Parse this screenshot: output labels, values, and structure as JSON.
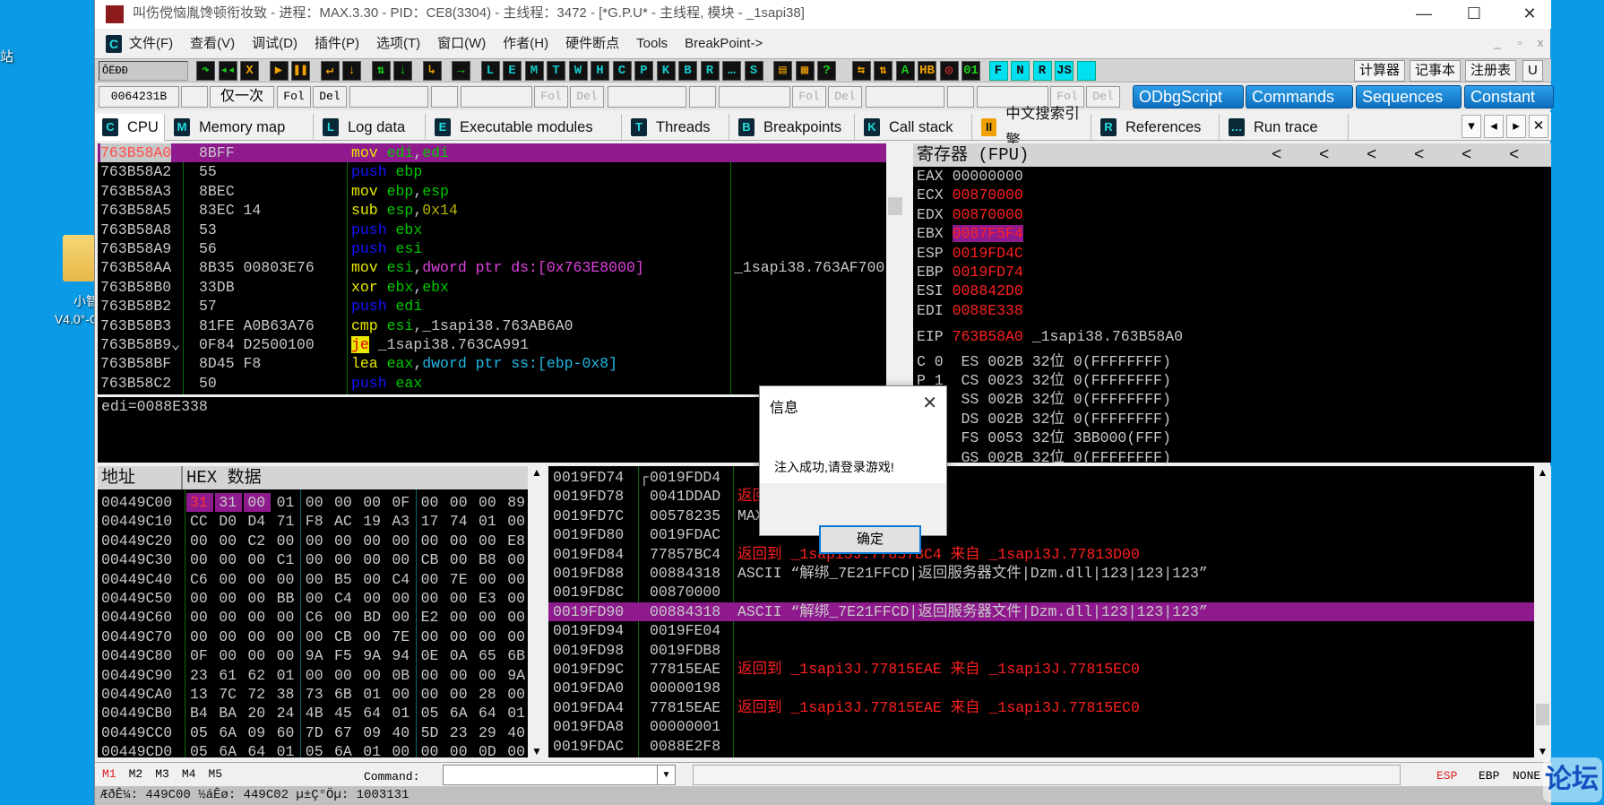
{
  "desktop": {
    "top_label": "站",
    "folder_label_1": "小智",
    "folder_label_2": "V4.0°-C"
  },
  "window": {
    "title": "叫伤傥恼胤馋顿衔妆致 - 进程：MAX.3.30 - PID：CE8(3304) - 主线程：3472 - [*G.P.U* -  主线程, 模块 - _1sapi38]",
    "min": "—",
    "max": "☐",
    "close": "✕"
  },
  "menu": {
    "items": [
      "文件(F)",
      "查看(V)",
      "调试(D)",
      "插件(P)",
      "选项(T)",
      "窗口(W)",
      "作者(H)",
      "硬件断点",
      "Tools",
      "BreakPoint->"
    ],
    "mdi": [
      "_",
      "▫",
      "x"
    ]
  },
  "toolbar": {
    "run_label": "ÔËÐÐ",
    "icons": [
      [
        "↷",
        "#19d119"
      ],
      [
        "◂◂",
        "#19d119"
      ],
      [
        "X",
        "#f0a000"
      ],
      [
        "▶",
        "#f0a000"
      ],
      [
        "❚❚",
        "#f0a000"
      ],
      [
        "↵",
        "#f0a000"
      ],
      [
        "↓",
        "#f0a000"
      ],
      [
        "⇅",
        "#19d119"
      ],
      [
        "↓",
        "#19d119"
      ],
      [
        "↳",
        "#f0a000"
      ],
      [
        "→",
        "#19d119"
      ],
      [
        "L",
        "#18c8c8"
      ],
      [
        "E",
        "#18c8c8"
      ],
      [
        "M",
        "#18c8c8"
      ],
      [
        "T",
        "#18c8c8"
      ],
      [
        "W",
        "#18c8c8"
      ],
      [
        "H",
        "#18c8c8"
      ],
      [
        "C",
        "#18c8c8"
      ],
      [
        "P",
        "#18c8c8"
      ],
      [
        "K",
        "#18c8c8"
      ],
      [
        "B",
        "#18c8c8"
      ],
      [
        "R",
        "#18c8c8"
      ],
      [
        "…",
        "#18c8c8"
      ],
      [
        "S",
        "#18c8c8"
      ],
      [
        "▤",
        "#f0a000"
      ],
      [
        "▦",
        "#f0a000"
      ],
      [
        "?",
        "#19d119"
      ],
      [
        "⇆",
        "#f0a000"
      ],
      [
        "⇅",
        "#f0a000"
      ],
      [
        "A",
        "#19d119"
      ],
      [
        "HB",
        "#f0a000"
      ],
      [
        "◎",
        "#e03030"
      ],
      [
        "01",
        "#19d119"
      ],
      [
        "F",
        "#111"
      ],
      [
        "N",
        "#111"
      ],
      [
        "R",
        "#111"
      ],
      [
        "JS",
        "#111"
      ],
      [
        "",
        "#111"
      ]
    ],
    "right_buttons": [
      "计算器",
      "记事本",
      "注册表",
      "U"
    ]
  },
  "row2": {
    "address": "0064231B",
    "once": "仅一次",
    "fol": "Fol",
    "del": "Del",
    "script_buttons": [
      "ODbgScript",
      "Commands",
      "Sequences",
      "Constant"
    ]
  },
  "tabs": [
    {
      "icon": "C",
      "label": "CPU"
    },
    {
      "icon": "M",
      "label": "Memory map"
    },
    {
      "icon": "L",
      "label": "Log data"
    },
    {
      "icon": "E",
      "label": "Executable modules"
    },
    {
      "icon": "T",
      "label": "Threads"
    },
    {
      "icon": "B",
      "label": "Breakpoints"
    },
    {
      "icon": "K",
      "label": "Call stack"
    },
    {
      "icon": "II",
      "label": "中文搜索引擎"
    },
    {
      "icon": "R",
      "label": "References"
    },
    {
      "icon": "…",
      "label": "Run trace"
    }
  ],
  "tab_nav": [
    "▾",
    "◂",
    "▸",
    "✕"
  ],
  "disasm": [
    {
      "addr": "763B58A0",
      "mark": "",
      "hex": "8BFF",
      "ins": [
        [
          "mov",
          "y"
        ],
        [
          " edi",
          "g"
        ],
        [
          ",",
          "w"
        ],
        [
          "edi",
          "g"
        ]
      ],
      "cmt": "",
      "sel": true
    },
    {
      "addr": "763B58A2",
      "mark": "",
      "hex": "55",
      "ins": [
        [
          "push",
          "b"
        ],
        [
          " ebp",
          "g"
        ]
      ],
      "cmt": ""
    },
    {
      "addr": "763B58A3",
      "mark": "",
      "hex": "8BEC",
      "ins": [
        [
          "mov",
          "y"
        ],
        [
          " ebp",
          "g"
        ],
        [
          ",",
          "w"
        ],
        [
          "esp",
          "g"
        ]
      ],
      "cmt": ""
    },
    {
      "addr": "763B58A5",
      "mark": "",
      "hex": "83EC 14",
      "ins": [
        [
          "sub",
          "y"
        ],
        [
          " esp",
          "g"
        ],
        [
          ",",
          "w"
        ],
        [
          "0x14",
          "o"
        ]
      ],
      "cmt": ""
    },
    {
      "addr": "763B58A8",
      "mark": "",
      "hex": "53",
      "ins": [
        [
          "push",
          "b"
        ],
        [
          " ebx",
          "g"
        ]
      ],
      "cmt": ""
    },
    {
      "addr": "763B58A9",
      "mark": "",
      "hex": "56",
      "ins": [
        [
          "push",
          "b"
        ],
        [
          " esi",
          "g"
        ]
      ],
      "cmt": ""
    },
    {
      "addr": "763B58AA",
      "mark": "",
      "hex": "8B35 00803E76",
      "ins": [
        [
          "mov",
          "y"
        ],
        [
          " esi",
          "g"
        ],
        [
          ",",
          "w"
        ],
        [
          "dword ptr ds:[0x763E8000]",
          "m"
        ]
      ],
      "cmt": "_1sapi38.763AF700"
    },
    {
      "addr": "763B58B0",
      "mark": "",
      "hex": "33DB",
      "ins": [
        [
          "xor",
          "y"
        ],
        [
          " ebx",
          "g"
        ],
        [
          ",",
          "w"
        ],
        [
          "ebx",
          "g"
        ]
      ],
      "cmt": ""
    },
    {
      "addr": "763B58B2",
      "mark": "",
      "hex": "57",
      "ins": [
        [
          "push",
          "b"
        ],
        [
          " edi",
          "g"
        ]
      ],
      "cmt": ""
    },
    {
      "addr": "763B58B3",
      "mark": "",
      "hex": "81FE A0B63A76",
      "ins": [
        [
          "cmp",
          "y"
        ],
        [
          " esi",
          "g"
        ],
        [
          ",",
          "w"
        ],
        [
          "_1sapi38.763AB6A0",
          "w"
        ]
      ],
      "cmt": ""
    },
    {
      "addr": "763B58B9",
      "mark": "⌄",
      "hex": "0F84 D2500100",
      "ins": [
        [
          "je",
          "jh"
        ],
        [
          " _1sapi38.763CA991",
          "w"
        ]
      ],
      "cmt": ""
    },
    {
      "addr": "763B58BF",
      "mark": "",
      "hex": "8D45 F8",
      "ins": [
        [
          "lea",
          "y"
        ],
        [
          " eax",
          "g"
        ],
        [
          ",",
          "w"
        ],
        [
          "dword ptr ss:[ebp-0x8]",
          "c"
        ]
      ],
      "cmt": ""
    },
    {
      "addr": "763B58C2",
      "mark": "",
      "hex": "50",
      "ins": [
        [
          "push",
          "b"
        ],
        [
          " eax",
          "g"
        ]
      ],
      "cmt": ""
    }
  ],
  "info": {
    "text": "edi=0088E338"
  },
  "registers": {
    "title": "寄存器 (FPU)",
    "arrows": [
      "<",
      "<",
      "<",
      "<",
      "<",
      "<"
    ],
    "gp": [
      [
        "EAX",
        "00000000",
        false
      ],
      [
        "ECX",
        "00870000",
        true
      ],
      [
        "EDX",
        "00870000",
        true
      ],
      [
        "EBX",
        "0087F5F4",
        true
      ],
      [
        "ESP",
        "0019FD4C",
        true
      ],
      [
        "EBP",
        "0019FD74",
        true
      ],
      [
        "ESI",
        "008842D0",
        true
      ],
      [
        "EDI",
        "0088E338",
        true
      ]
    ],
    "eip": {
      "name": "EIP",
      "value": "763B58A0",
      "label": "_1sapi38.763B58A0"
    },
    "seg": [
      "C 0  ES 002B 32位 0(FFFFFFFF)",
      "P 1  CS 0023 32位 0(FFFFFFFF)",
      "     SS 002B 32位 0(FFFFFFFF)",
      "     DS 002B 32位 0(FFFFFFFF)",
      "     FS 0053 32位 3BB000(FFF)",
      "     GS 002B 32位 0(FFFFFFFF)"
    ]
  },
  "dump": {
    "col_addr": "地址",
    "col_hex": "HEX 数据",
    "rows": [
      [
        "00449C00",
        "31 31 00 01 00 00 00 0F 00 00 00 89"
      ],
      [
        "00449C10",
        "CC D0 D4 71 F8 AC 19 A3 17 74 01 00"
      ],
      [
        "00449C20",
        "00 00 C2 00 00 00 00 00 00 00 00 E8"
      ],
      [
        "00449C30",
        "00 00 00 C1 00 00 00 00 CB 00 B8 00"
      ],
      [
        "00449C40",
        "C6 00 00 00 00 B5 00 C4 00 7E 00 00"
      ],
      [
        "00449C50",
        "00 00 00 BB 00 C4 00 00 00 00 E3 00"
      ],
      [
        "00449C60",
        "00 00 00 00 C6 00 BD 00 E2 00 00 00"
      ],
      [
        "00449C70",
        "00 00 00 00 00 CB 00 7E 00 00 00 00"
      ],
      [
        "00449C80",
        "0F 00 00 00 9A F5 9A 94 0E 0A 65 6B"
      ],
      [
        "00449C90",
        "23 61 62 01 00 00 00 0B 00 00 00 9A"
      ],
      [
        "00449CA0",
        "13 7C 72 38 73 6B 01 00 00 00 28 00"
      ],
      [
        "00449CB0",
        "B4 BA 20 24 4B 45 64 01 05 6A 64 01"
      ],
      [
        "00449CC0",
        "05 6A 09 60 7D 67 09 40 5D 23 29 40"
      ],
      [
        "00449CD0",
        "05 6A 64 01 05 6A 01 00 00 00 0D 00"
      ]
    ]
  },
  "stack": [
    {
      "addr": "0019FD74",
      "val": "0019FDD4",
      "cmt": "",
      "red": false,
      "br": "┌"
    },
    {
      "addr": "0019FD78",
      "val": "0041DDAD",
      "cmt": "返回到 MAX.0041DDAD",
      "red": true
    },
    {
      "addr": "0019FD7C",
      "val": "00578235",
      "cmt": "MAX.00578235",
      "red": false
    },
    {
      "addr": "0019FD80",
      "val": "0019FDAC",
      "cmt": "",
      "red": false
    },
    {
      "addr": "0019FD84",
      "val": "77857BC4",
      "cmt": "返回到 _1sapi3J.77857BC4 来自 _1sapi3J.77813D00",
      "red": true
    },
    {
      "addr": "0019FD88",
      "val": "00884318",
      "cmt": "ASCII “解绑_7E21FFCD|返回服务器文件|Dzm.dll|123|123|123”",
      "red": false
    },
    {
      "addr": "0019FD8C",
      "val": "00870000",
      "cmt": "",
      "red": false
    },
    {
      "addr": "0019FD90",
      "val": "00884318",
      "cmt": "ASCII “解绑_7E21FFCD|返回服务器文件|Dzm.dll|123|123|123”",
      "red": false,
      "sel": true
    },
    {
      "addr": "0019FD94",
      "val": "0019FE04",
      "cmt": "",
      "red": false
    },
    {
      "addr": "0019FD98",
      "val": "0019FDB8",
      "cmt": "",
      "red": false
    },
    {
      "addr": "0019FD9C",
      "val": "77815EAE",
      "cmt": "返回到 _1sapi3J.77815EAE 来自 _1sapi3J.77815EC0",
      "red": true
    },
    {
      "addr": "0019FDA0",
      "val": "00000198",
      "cmt": "",
      "red": false
    },
    {
      "addr": "0019FDA4",
      "val": "77815EAE",
      "cmt": "返回到 _1sapi3J.77815EAE 来自 _1sapi3J.77815EC0",
      "red": true
    },
    {
      "addr": "0019FDA8",
      "val": "00000001",
      "cmt": "",
      "red": false
    },
    {
      "addr": "0019FDAC",
      "val": "0088E2F8",
      "cmt": "",
      "red": false
    }
  ],
  "dialog": {
    "title": "信息",
    "message": "注入成功,请登录游戏!",
    "ok": "确定",
    "close": "✕"
  },
  "cmdbar": {
    "marks": [
      "M1",
      "M2",
      "M3",
      "M4",
      "M5"
    ],
    "command_label": "Command:",
    "command_value": "",
    "regs": [
      "ESP",
      "EBP",
      "NONE"
    ]
  },
  "status": "ÆðÊ¼: 449C00 ½áÊø: 449C02 µ±Ç°Öµ: 1003131",
  "watermark": "论坛"
}
